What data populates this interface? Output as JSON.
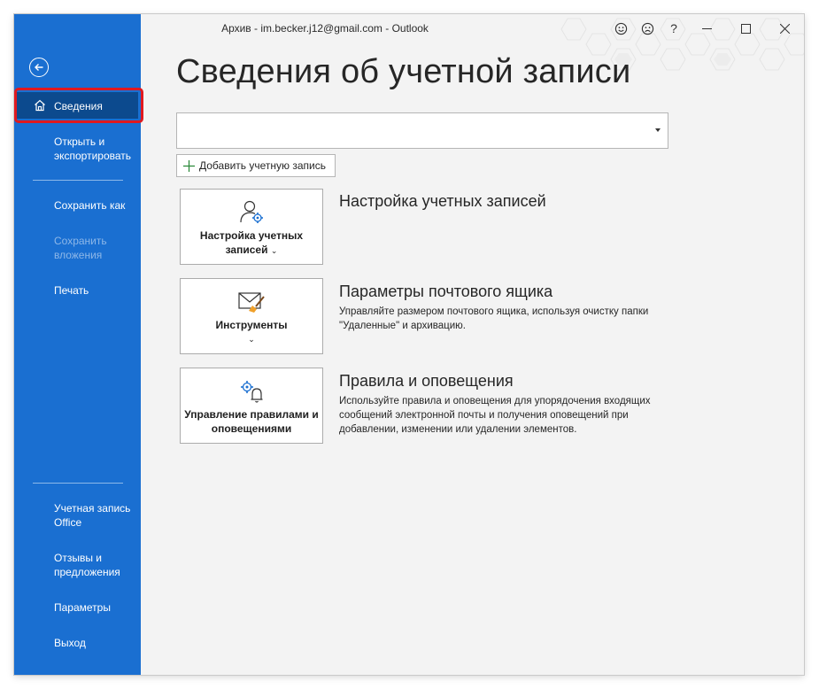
{
  "window": {
    "title": "Архив - im.becker.j12@gmail.com - Outlook",
    "help_label": "?"
  },
  "sidebar": {
    "items": [
      {
        "label": "Сведения",
        "active": true
      },
      {
        "label": "Открыть и\nэкспортировать"
      },
      {
        "label": "Сохранить как"
      },
      {
        "label": "Сохранить\nвложения",
        "disabled": true
      },
      {
        "label": "Печать"
      },
      {
        "label": "Учетная запись\nOffice"
      },
      {
        "label": "Отзывы и\nпредложения"
      },
      {
        "label": "Параметры"
      },
      {
        "label": "Выход"
      }
    ]
  },
  "main": {
    "page_title": "Сведения об учетной записи",
    "add_account_label": "Добавить учетную запись",
    "sections": [
      {
        "tile_label": "Настройка учетных записей",
        "title": "Настройка учетных записей",
        "desc": ""
      },
      {
        "tile_label": "Инструменты",
        "title": "Параметры почтового ящика",
        "desc": "Управляйте размером почтового ящика, используя очистку папки \"Удаленные\" и архивацию."
      },
      {
        "tile_label": "Управление правилами и оповещениями",
        "title": "Правила и оповещения",
        "desc": "Используйте правила и оповещения для упорядочения входящих сообщений электронной почты и получения оповещений при добавлении, изменении или удалении элементов."
      }
    ]
  },
  "colors": {
    "sidebar_bg": "#1a6fd1",
    "active_bg": "#0c4a8e",
    "highlight_border": "#e0191f",
    "main_bg": "#f3f3f3"
  },
  "icons": [
    "back-arrow-icon",
    "home-icon",
    "smile-icon",
    "frown-icon",
    "help-icon",
    "minimize-icon",
    "maximize-icon",
    "close-icon",
    "dropdown-arrow-icon",
    "plus-icon",
    "account-settings-icon",
    "mailbox-tools-icon",
    "rules-alerts-icon"
  ]
}
